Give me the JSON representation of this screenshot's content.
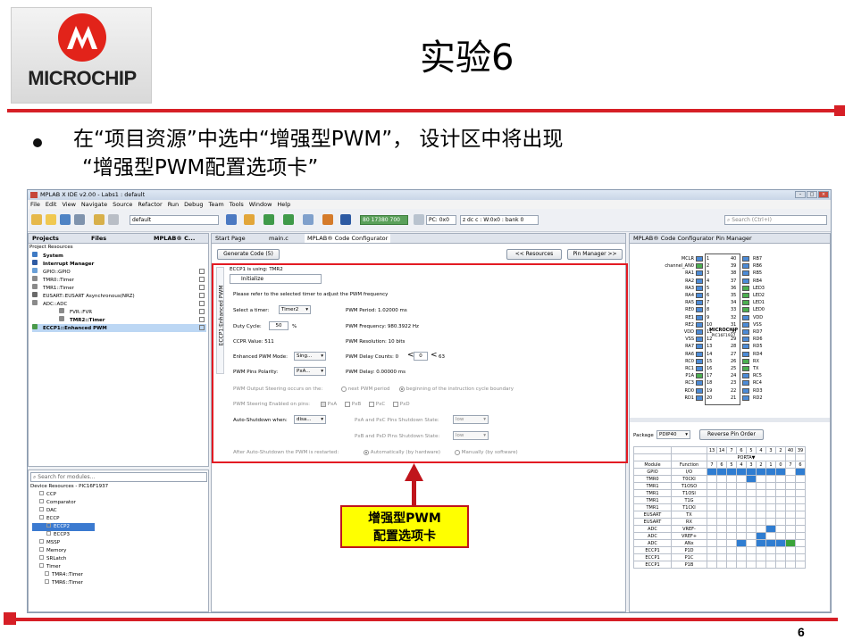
{
  "slide": {
    "logo_text": "MICROCHIP",
    "title": "实验6",
    "bullet_line1": "在“项目资源”中选中“增强型PWM”， 设计区中将出现",
    "bullet_line2": "“增强型PWM配置选项卡”",
    "page_number": "6",
    "callout_line1": "增强型PWM",
    "callout_line2": "配置选项卡",
    "accent_color": "#d61f26",
    "callout_color": "#ffff00"
  },
  "ide": {
    "window_title": "MPLAB X IDE v2.00 - Labs1 : default",
    "menu": [
      "File",
      "Edit",
      "View",
      "Navigate",
      "Source",
      "Refactor",
      "Run",
      "Debug",
      "Team",
      "Tools",
      "Window",
      "Help"
    ],
    "config_combo": "default",
    "status_pc": "PC: 0x0",
    "status_bits": "z dc c  : W:0x0 : bank 0",
    "status_memory": "80 17380 700",
    "search_placeholder": "Search (Ctrl+I)",
    "left_tabs": [
      "Projects",
      "Files",
      "MPLAB® C..."
    ],
    "project_resources_label": "Project Resources",
    "project_tree": [
      "System",
      "Interrupt Manager",
      "GPIO::GPIO",
      "TMR0::Timer",
      "TMR1::Timer",
      "EUSART::EUSART Asynchronous(NRZ)",
      "ADC::ADC",
      "FVR::FVR",
      "TMR2::Timer",
      "ECCP1::Enhanced PWM"
    ],
    "module_search_placeholder": "Search for modules...",
    "device_resources_title": "Device Resources - PIC16F1937",
    "device_tree": [
      "CCP",
      "Comparator",
      "DAC",
      "ECCP",
      "ECCP2",
      "ECCP3",
      "MSSP",
      "Memory",
      "SRLatch",
      "Timer",
      "TMR4::Timer",
      "TMR6::Timer"
    ],
    "editor_tabs": [
      "Start Page",
      "main.c",
      "MPLAB® Code Configurator"
    ],
    "generate_button": "Generate Code (5)",
    "resources_button": "<< Resources",
    "pin_manager_button": "Pin Manager >>",
    "side_tab": "ECCP1:Enhanced PWM",
    "eccp_using": "ECCP1 is using: TMR2",
    "init_label": "Initialize",
    "pwm": {
      "instruction": "Please refer to the selected timer to adjust the PWM frequency",
      "timer_label": "Select a timer:",
      "timer_value": "Timer2",
      "duty_label": "Duty Cycle:",
      "duty_value": "50",
      "duty_unit": "%",
      "ccpr_label": "CCPR Value: 511",
      "mode_label": "Enhanced PWM  Mode:",
      "mode_value": "Sing...",
      "polarity_label": "PWM Pins Polarity:",
      "polarity_value": "PxA...",
      "period": "PWM Period: 1.02000 ms",
      "frequency": "PWM Frequency: 980.3922 Hz",
      "resolution": "PWM Resolution: 10 bits",
      "dead_band_label": "PWM Delay Counts: 0",
      "dead_band_value": "0",
      "dead_band_max": "63",
      "delay": "PWM Delay: 0.00000 ms",
      "steering_occurs_label": "PWM Output Steering occurs on the:",
      "steering_opt1": "next PWM period",
      "steering_opt2": "beginning of the instruction cycle boundary",
      "steering_enabled_label": "PWM Steering Enabled on pins:",
      "steer_pins": [
        "PxA",
        "PxB",
        "PxC",
        "PxD"
      ],
      "autoshutdown_label": "Auto-Shutdown when:",
      "autoshutdown_value": "disa...",
      "ac_state_label": "PxA and PxC Pins Shutdown State:",
      "ac_state_value": "low",
      "bd_state_label": "PxB and PxD Pins Shutdown State:",
      "bd_state_value": "low",
      "restart_label": "After Auto-Shutdown the PWM is restarted:",
      "restart_opt1": "Automatically (by hardware)",
      "restart_opt2": "Manually (by software)"
    },
    "pin_manager_title": "MPLAB® Code Configurator Pin Manager",
    "chip_name": "PIC16F1937",
    "pins_left": [
      {
        "n": "1",
        "name": "MCLR"
      },
      {
        "n": "2",
        "name": "channel_AN0"
      },
      {
        "n": "3",
        "name": "RA1"
      },
      {
        "n": "4",
        "name": "RA2"
      },
      {
        "n": "5",
        "name": "RA3"
      },
      {
        "n": "6",
        "name": "RA4"
      },
      {
        "n": "7",
        "name": "RA5"
      },
      {
        "n": "8",
        "name": "RE0"
      },
      {
        "n": "9",
        "name": "RE1"
      },
      {
        "n": "10",
        "name": "RE2"
      },
      {
        "n": "11",
        "name": "VDD"
      },
      {
        "n": "12",
        "name": "VSS"
      },
      {
        "n": "13",
        "name": "RA7"
      },
      {
        "n": "14",
        "name": "RA6"
      },
      {
        "n": "15",
        "name": "RC0"
      },
      {
        "n": "16",
        "name": "RC1"
      },
      {
        "n": "17",
        "name": "P1A"
      },
      {
        "n": "18",
        "name": "RC3"
      },
      {
        "n": "19",
        "name": "RD0"
      },
      {
        "n": "20",
        "name": "RD1"
      }
    ],
    "pins_right": [
      {
        "n": "40",
        "name": "RB7"
      },
      {
        "n": "39",
        "name": "RB6"
      },
      {
        "n": "38",
        "name": "RB5"
      },
      {
        "n": "37",
        "name": "RB4"
      },
      {
        "n": "36",
        "name": "LED3"
      },
      {
        "n": "35",
        "name": "LED2"
      },
      {
        "n": "34",
        "name": "LED1"
      },
      {
        "n": "33",
        "name": "LED0"
      },
      {
        "n": "32",
        "name": "VDD"
      },
      {
        "n": "31",
        "name": "VSS"
      },
      {
        "n": "30",
        "name": "RD7"
      },
      {
        "n": "29",
        "name": "RD6"
      },
      {
        "n": "28",
        "name": "RD5"
      },
      {
        "n": "27",
        "name": "RD4"
      },
      {
        "n": "26",
        "name": "RX"
      },
      {
        "n": "25",
        "name": "TX"
      },
      {
        "n": "24",
        "name": "RC5"
      },
      {
        "n": "23",
        "name": "RC4"
      },
      {
        "n": "22",
        "name": "RD3"
      },
      {
        "n": "21",
        "name": "RD2"
      }
    ],
    "package_label": "Package",
    "package_value": "PDIP40",
    "reverse_button": "Reverse Pin Order",
    "pin_header_top": [
      "13",
      "14",
      "7",
      "6",
      "5",
      "4",
      "3",
      "2",
      "40",
      "39"
    ],
    "porta_label": "PORTA▼",
    "grid_header": [
      "Module",
      "Function",
      "7",
      "6",
      "5",
      "4",
      "3",
      "2",
      "1",
      "0",
      "7",
      "6"
    ],
    "grid_rows": [
      {
        "module": "GPIO",
        "function": "I/O",
        "cells": "bbbbbbbb.bb"
      },
      {
        "module": "TMR0",
        "function": "T0CKI",
        "cells": "....b......"
      },
      {
        "module": "TMR1",
        "function": "T1OSO",
        "cells": "..........."
      },
      {
        "module": "TMR1",
        "function": "T1OSI",
        "cells": "..........."
      },
      {
        "module": "TMR1",
        "function": "T1G",
        "cells": "..........."
      },
      {
        "module": "TMR1",
        "function": "T1CKI",
        "cells": "..........."
      },
      {
        "module": "EUSART",
        "function": "TX",
        "cells": "..........."
      },
      {
        "module": "EUSART",
        "function": "RX",
        "cells": "..........."
      },
      {
        "module": "ADC",
        "function": "VREF-",
        "cells": "......b...."
      },
      {
        "module": "ADC",
        "function": "VREF+",
        "cells": ".....b....."
      },
      {
        "module": "ADC",
        "function": "ANx",
        "cells": "...b.bbbg.."
      },
      {
        "module": "ECCP1",
        "function": "P1D",
        "cells": "..........."
      },
      {
        "module": "ECCP1",
        "function": "P1C",
        "cells": "..........."
      },
      {
        "module": "ECCP1",
        "function": "P1B",
        "cells": "..........."
      }
    ]
  }
}
